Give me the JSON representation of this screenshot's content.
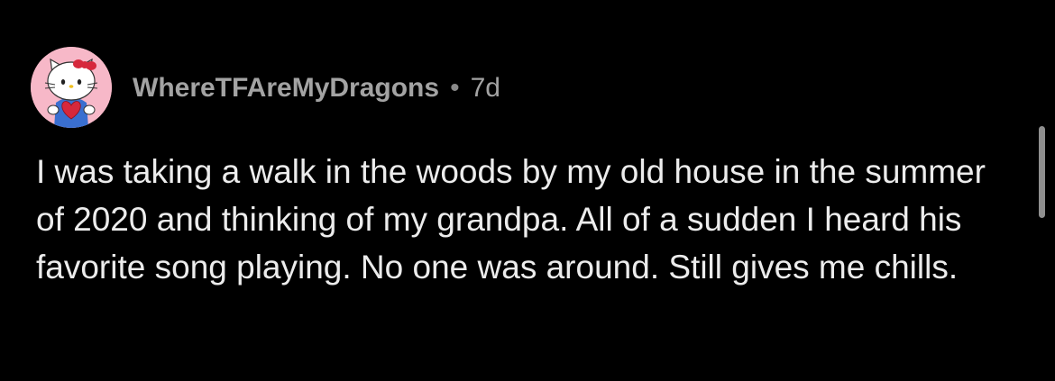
{
  "comment": {
    "username": "WhereTFAreMyDragons",
    "separator": "•",
    "age": "7d",
    "body": "I was taking a walk in the woods by my old house in the summer of 2020 and thinking of my grandpa. All of a sudden I heard his favorite song playing. No one was around. Still gives me chills.",
    "avatar_icon": "hello-kitty-avatar-icon"
  },
  "colors": {
    "background": "#000000",
    "text": "#ececec",
    "meta": "#a3a3a3",
    "avatar_bg": "#f7b8c8"
  }
}
